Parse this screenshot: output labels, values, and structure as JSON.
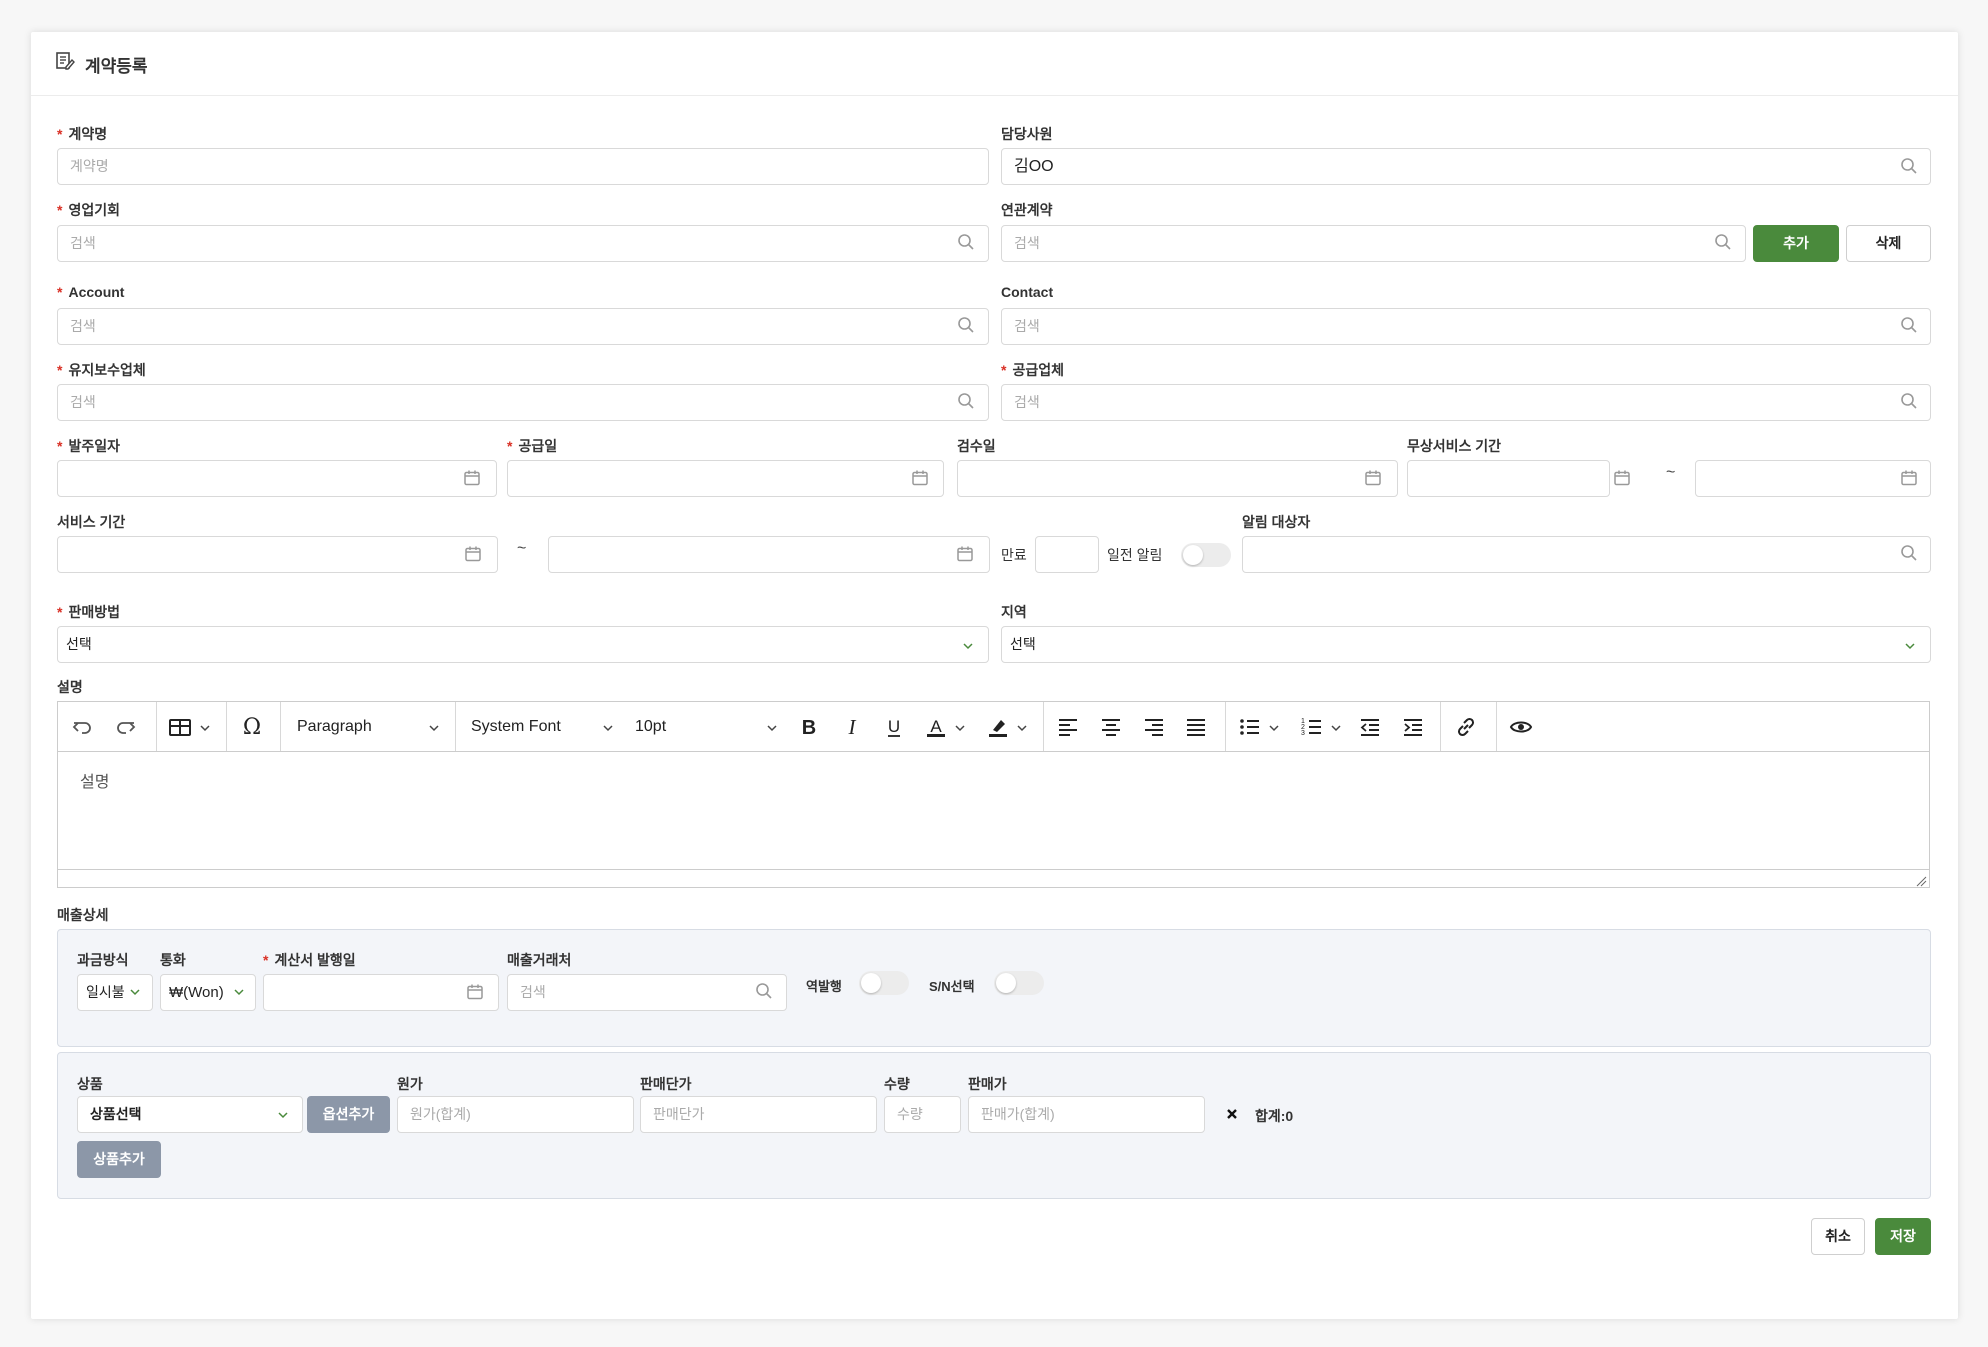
{
  "header": {
    "title": "계약등록",
    "icon": "document-edit-icon"
  },
  "form": {
    "contract_name": {
      "label": "계약명",
      "placeholder": "계약명"
    },
    "manager": {
      "label": "담당사원",
      "value": "김OO"
    },
    "sales_opportunity": {
      "label": "영업기회",
      "placeholder": "검색"
    },
    "related_contract": {
      "label": "연관계약",
      "placeholder": "검색",
      "add_label": "추가",
      "delete_label": "삭제"
    },
    "account": {
      "label": "Account",
      "placeholder": "검색"
    },
    "contact": {
      "label": "Contact",
      "placeholder": "검색"
    },
    "maintenance_vendor": {
      "label": "유지보수업체",
      "placeholder": "검색"
    },
    "supplier": {
      "label": "공급업체",
      "placeholder": "검색"
    },
    "order_date": {
      "label": "발주일자"
    },
    "supply_date": {
      "label": "공급일"
    },
    "inspection_date": {
      "label": "검수일"
    },
    "free_service_period": {
      "label": "무상서비스 기간",
      "tilde": "~"
    },
    "service_period": {
      "label": "서비스 기간",
      "tilde": "~"
    },
    "expiry": {
      "label": "만료"
    },
    "advance_notice": {
      "label": "일전 알림",
      "on": false
    },
    "notify_target": {
      "label": "알림 대상자"
    },
    "sales_method": {
      "label": "판매방법",
      "value": "선택"
    },
    "region": {
      "label": "지역",
      "value": "선택"
    },
    "description": {
      "label": "설명",
      "placeholder": "설명"
    }
  },
  "editor_toolbar": {
    "paragraph": "Paragraph",
    "font": "System Font",
    "size": "10pt"
  },
  "sales_detail": {
    "label": "매출상세",
    "billing_method": {
      "label": "과금방식",
      "value": "일시불"
    },
    "currency": {
      "label": "통화",
      "value": "₩(Won)"
    },
    "invoice_date": {
      "label": "계산서 발행일"
    },
    "sales_partner": {
      "label": "매출거래처",
      "placeholder": "검색"
    },
    "reverse_issue": {
      "label": "역발행",
      "on": false
    },
    "sn_select": {
      "label": "S/N선택",
      "on": false
    }
  },
  "product": {
    "product_label": "상품",
    "product_value": "상품선택",
    "add_option": "옵션추가",
    "cost_label": "원가",
    "cost_placeholder": "원가(합계)",
    "unit_price_label": "판매단가",
    "unit_price_placeholder": "판매단가",
    "qty_label": "수량",
    "qty_placeholder": "수량",
    "sale_price_label": "판매가",
    "sale_price_placeholder": "판매가(합계)",
    "remove_icon": "close-icon",
    "total": "합계:0",
    "add_product": "상품추가"
  },
  "footer": {
    "cancel": "취소",
    "save": "저장"
  },
  "colors": {
    "primary": "#4a8a3c",
    "required": "#d93025",
    "gray_button": "#8c97a8"
  }
}
